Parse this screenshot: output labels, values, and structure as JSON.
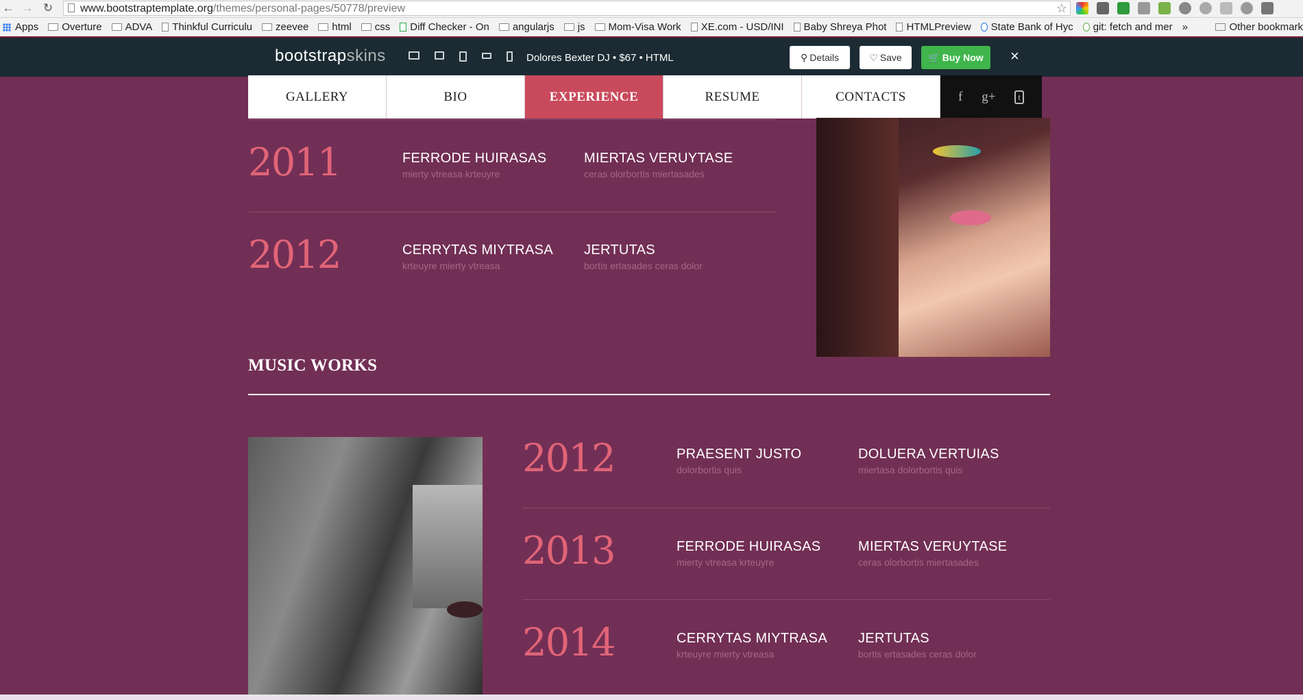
{
  "browser": {
    "url_domain": "www.bootstraptemplate.org",
    "url_path": "/themes/personal-pages/50778/preview",
    "bookmarks": [
      "Apps",
      "Overture",
      "ADVA",
      "Thinkful Curriculu",
      "zeevee",
      "html",
      "css",
      "Diff Checker - On",
      "angularjs",
      "js",
      "Mom-Visa Work",
      "XE.com - USD/INI",
      "Baby Shreya Phot",
      "HTMLPreview",
      "State Bank of Hyc",
      "git: fetch and mer",
      "»"
    ],
    "other_bookmarks": "Other bookmark"
  },
  "previewbar": {
    "brand_main": "bootstrap",
    "brand_sub": "skins",
    "theme_title": "Dolores Bexter DJ • $67 • HTML",
    "details_label": "Details",
    "save_label": "Save",
    "buy_label": "Buy Now",
    "close_label": "×"
  },
  "nav": {
    "items": [
      {
        "label": "GALLERY"
      },
      {
        "label": "BIO"
      },
      {
        "label": "EXPERIENCE"
      },
      {
        "label": "RESUME"
      },
      {
        "label": "CONTACTS"
      }
    ],
    "active": "EXPERIENCE",
    "social": [
      "f",
      "g+",
      "t"
    ]
  },
  "experience": [
    {
      "year": "2011",
      "col1_title": "FERRODE HUIRASAS",
      "col1_sub": "mierty vtreasa krteuyre",
      "col2_title": "MIERTAS VERUYTASE",
      "col2_sub": "ceras olorbortis miertasades"
    },
    {
      "year": "2012",
      "col1_title": "CERRYTAS MIYTRASA",
      "col1_sub": "krteuyre mierty vtreasa",
      "col2_title": "JERTUTAS",
      "col2_sub": "bortis ertasades ceras dolor"
    }
  ],
  "music_works": {
    "title": "MUSIC WORKS",
    "rows": [
      {
        "year": "2012",
        "col1_title": "PRAESENT JUSTO",
        "col1_sub": "dolorbortis quis",
        "col2_title": "DOLUERA VERTUIAS",
        "col2_sub": "miertasa dolorbortis quis"
      },
      {
        "year": "2013",
        "col1_title": "FERRODE HUIRASAS",
        "col1_sub": "mierty vtreasa krteuyre",
        "col2_title": "MIERTAS VERUYTASE",
        "col2_sub": "ceras olorbortis miertasades"
      },
      {
        "year": "2014",
        "col1_title": "CERRYTAS MIYTRASA",
        "col1_sub": "krteuyre mierty vtreasa",
        "col2_title": "JERTUTAS",
        "col2_sub": "bortis ertasades ceras dolor"
      }
    ]
  },
  "colors": {
    "page_bg": "#722f55",
    "accent": "#e16478",
    "active_nav": "#c94a5c",
    "buy_green": "#3fb54b"
  }
}
